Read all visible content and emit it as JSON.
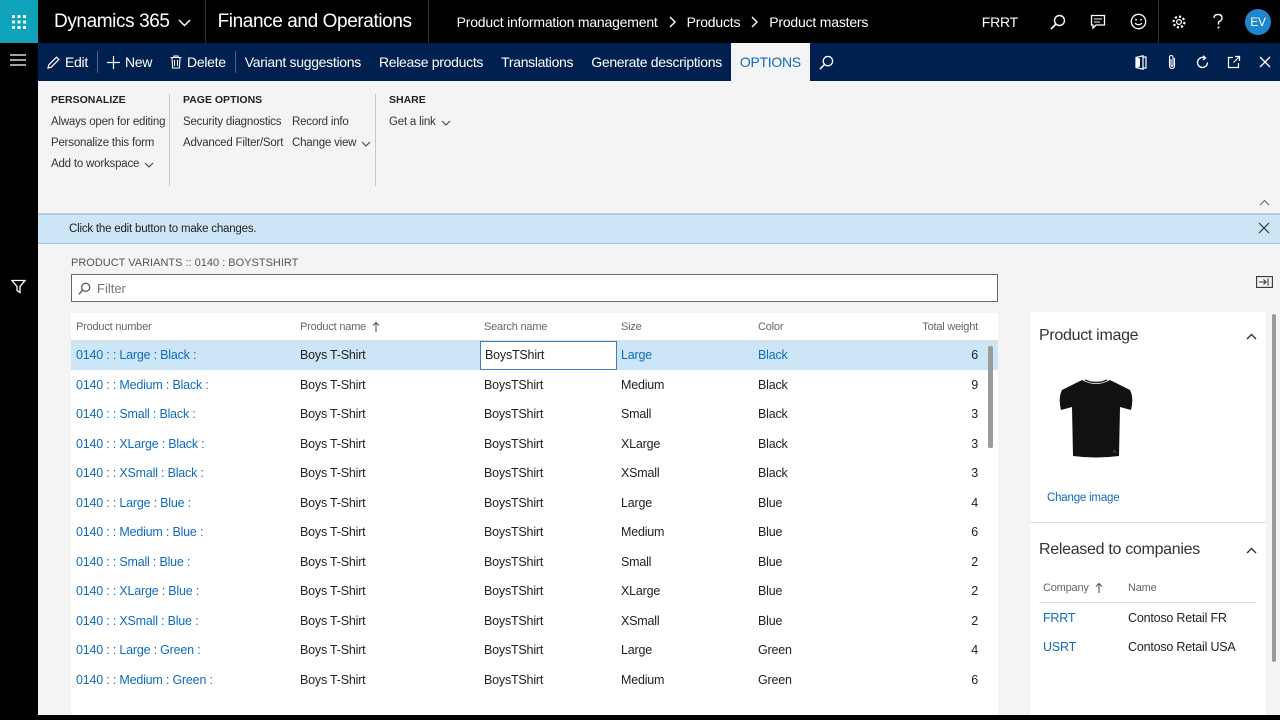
{
  "topbar": {
    "brand": "Dynamics 365",
    "app_name": "Finance and Operations",
    "breadcrumbs": [
      "Product information management",
      "Products",
      "Product masters"
    ],
    "company": "FRRT",
    "avatar_initials": "EV"
  },
  "actionbar": {
    "edit": "Edit",
    "new": "New",
    "delete": "Delete",
    "variant_suggestions": "Variant suggestions",
    "release_products": "Release products",
    "translations": "Translations",
    "generate_descriptions": "Generate descriptions",
    "options": "OPTIONS"
  },
  "ribbon": {
    "personalize": {
      "header": "PERSONALIZE",
      "items": [
        "Always open for editing",
        "Personalize this form",
        "Add to workspace"
      ]
    },
    "page_options": {
      "header": "PAGE OPTIONS",
      "col1": [
        "Security diagnostics",
        "Advanced Filter/Sort"
      ],
      "col2": [
        "Record info",
        "Change view"
      ]
    },
    "share": {
      "header": "SHARE",
      "items": [
        "Get a link"
      ]
    }
  },
  "message": "Click the edit button to make changes.",
  "grid": {
    "title": "PRODUCT VARIANTS :: 0140 : BOYSTSHIRT",
    "filter_placeholder": "Filter",
    "columns": [
      "Product number",
      "Product name",
      "Search name",
      "Size",
      "Color",
      "Total weight"
    ],
    "rows": [
      {
        "number": "0140 :  : Large : Black :",
        "name": "Boys T-Shirt",
        "search": "BoysTShirt",
        "size": "Large",
        "color": "Black",
        "weight": "6"
      },
      {
        "number": "0140 :  : Medium : Black :",
        "name": "Boys T-Shirt",
        "search": "BoysTShirt",
        "size": "Medium",
        "color": "Black",
        "weight": "9"
      },
      {
        "number": "0140 :  : Small : Black :",
        "name": "Boys T-Shirt",
        "search": "BoysTShirt",
        "size": "Small",
        "color": "Black",
        "weight": "3"
      },
      {
        "number": "0140 :  : XLarge : Black :",
        "name": "Boys T-Shirt",
        "search": "BoysTShirt",
        "size": "XLarge",
        "color": "Black",
        "weight": "3"
      },
      {
        "number": "0140 :  : XSmall : Black :",
        "name": "Boys T-Shirt",
        "search": "BoysTShirt",
        "size": "XSmall",
        "color": "Black",
        "weight": "3"
      },
      {
        "number": "0140 :  : Large : Blue :",
        "name": "Boys T-Shirt",
        "search": "BoysTShirt",
        "size": "Large",
        "color": "Blue",
        "weight": "4"
      },
      {
        "number": "0140 :  : Medium : Blue :",
        "name": "Boys T-Shirt",
        "search": "BoysTShirt",
        "size": "Medium",
        "color": "Blue",
        "weight": "6"
      },
      {
        "number": "0140 :  : Small : Blue :",
        "name": "Boys T-Shirt",
        "search": "BoysTShirt",
        "size": "Small",
        "color": "Blue",
        "weight": "2"
      },
      {
        "number": "0140 :  : XLarge : Blue :",
        "name": "Boys T-Shirt",
        "search": "BoysTShirt",
        "size": "XLarge",
        "color": "Blue",
        "weight": "2"
      },
      {
        "number": "0140 :  : XSmall : Blue :",
        "name": "Boys T-Shirt",
        "search": "BoysTShirt",
        "size": "XSmall",
        "color": "Blue",
        "weight": "2"
      },
      {
        "number": "0140 :  : Large : Green :",
        "name": "Boys T-Shirt",
        "search": "BoysTShirt",
        "size": "Large",
        "color": "Green",
        "weight": "4"
      },
      {
        "number": "0140 :  : Medium : Green :",
        "name": "Boys T-Shirt",
        "search": "BoysTShirt",
        "size": "Medium",
        "color": "Green",
        "weight": "6"
      }
    ]
  },
  "factbox": {
    "product_image_title": "Product image",
    "change_image": "Change image",
    "released_title": "Released to companies",
    "columns": [
      "Company",
      "Name"
    ],
    "companies": [
      {
        "company": "FRRT",
        "name": "Contoso Retail FR"
      },
      {
        "company": "USRT",
        "name": "Contoso Retail USA"
      }
    ]
  },
  "colors": {
    "nav_bar": "#002050",
    "accent": "#0f6cbd",
    "waffle": "#0fa3b9",
    "message_bar": "#cde6f7"
  }
}
